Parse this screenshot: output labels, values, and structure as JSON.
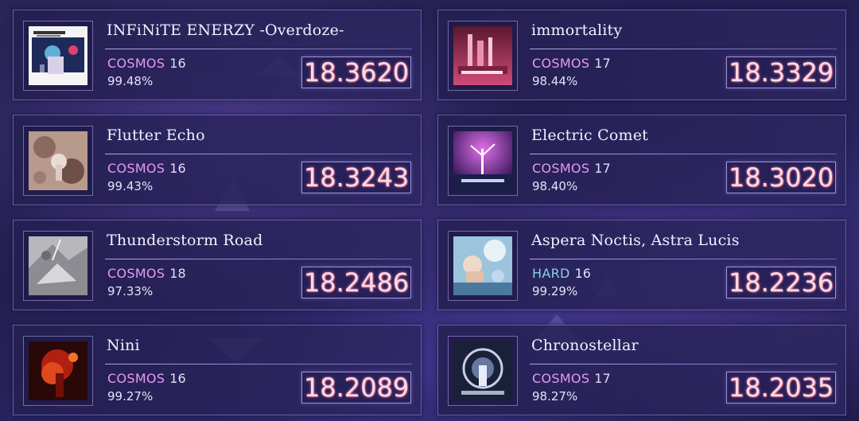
{
  "colors": {
    "cosmos": "#e59af0",
    "hard": "#8ccfe8",
    "rating_text": "#ffd9e2"
  },
  "records": [
    {
      "title": "INFiNiTE ENERZY -Overdoze-",
      "difficulty": "COSMOS",
      "level": "16",
      "accuracy": "99.48%",
      "rating": "18.3620",
      "jacket_icon": "album-jacket-art"
    },
    {
      "title": "immortality",
      "difficulty": "COSMOS",
      "level": "17",
      "accuracy": "98.44%",
      "rating": "18.3329",
      "jacket_icon": "album-jacket-art"
    },
    {
      "title": "Flutter Echo",
      "difficulty": "COSMOS",
      "level": "16",
      "accuracy": "99.43%",
      "rating": "18.3243",
      "jacket_icon": "album-jacket-art"
    },
    {
      "title": "Electric Comet",
      "difficulty": "COSMOS",
      "level": "17",
      "accuracy": "98.40%",
      "rating": "18.3020",
      "jacket_icon": "album-jacket-art"
    },
    {
      "title": "Thunderstorm Road",
      "difficulty": "COSMOS",
      "level": "18",
      "accuracy": "97.33%",
      "rating": "18.2486",
      "jacket_icon": "album-jacket-art"
    },
    {
      "title": "Aspera Noctis, Astra Lucis",
      "difficulty": "HARD",
      "level": "16",
      "accuracy": "99.29%",
      "rating": "18.2236",
      "jacket_icon": "album-jacket-art"
    },
    {
      "title": "Nini",
      "difficulty": "COSMOS",
      "level": "16",
      "accuracy": "99.27%",
      "rating": "18.2089",
      "jacket_icon": "album-jacket-art"
    },
    {
      "title": "Chronostellar",
      "difficulty": "COSMOS",
      "level": "17",
      "accuracy": "98.27%",
      "rating": "18.2035",
      "jacket_icon": "album-jacket-art"
    }
  ]
}
